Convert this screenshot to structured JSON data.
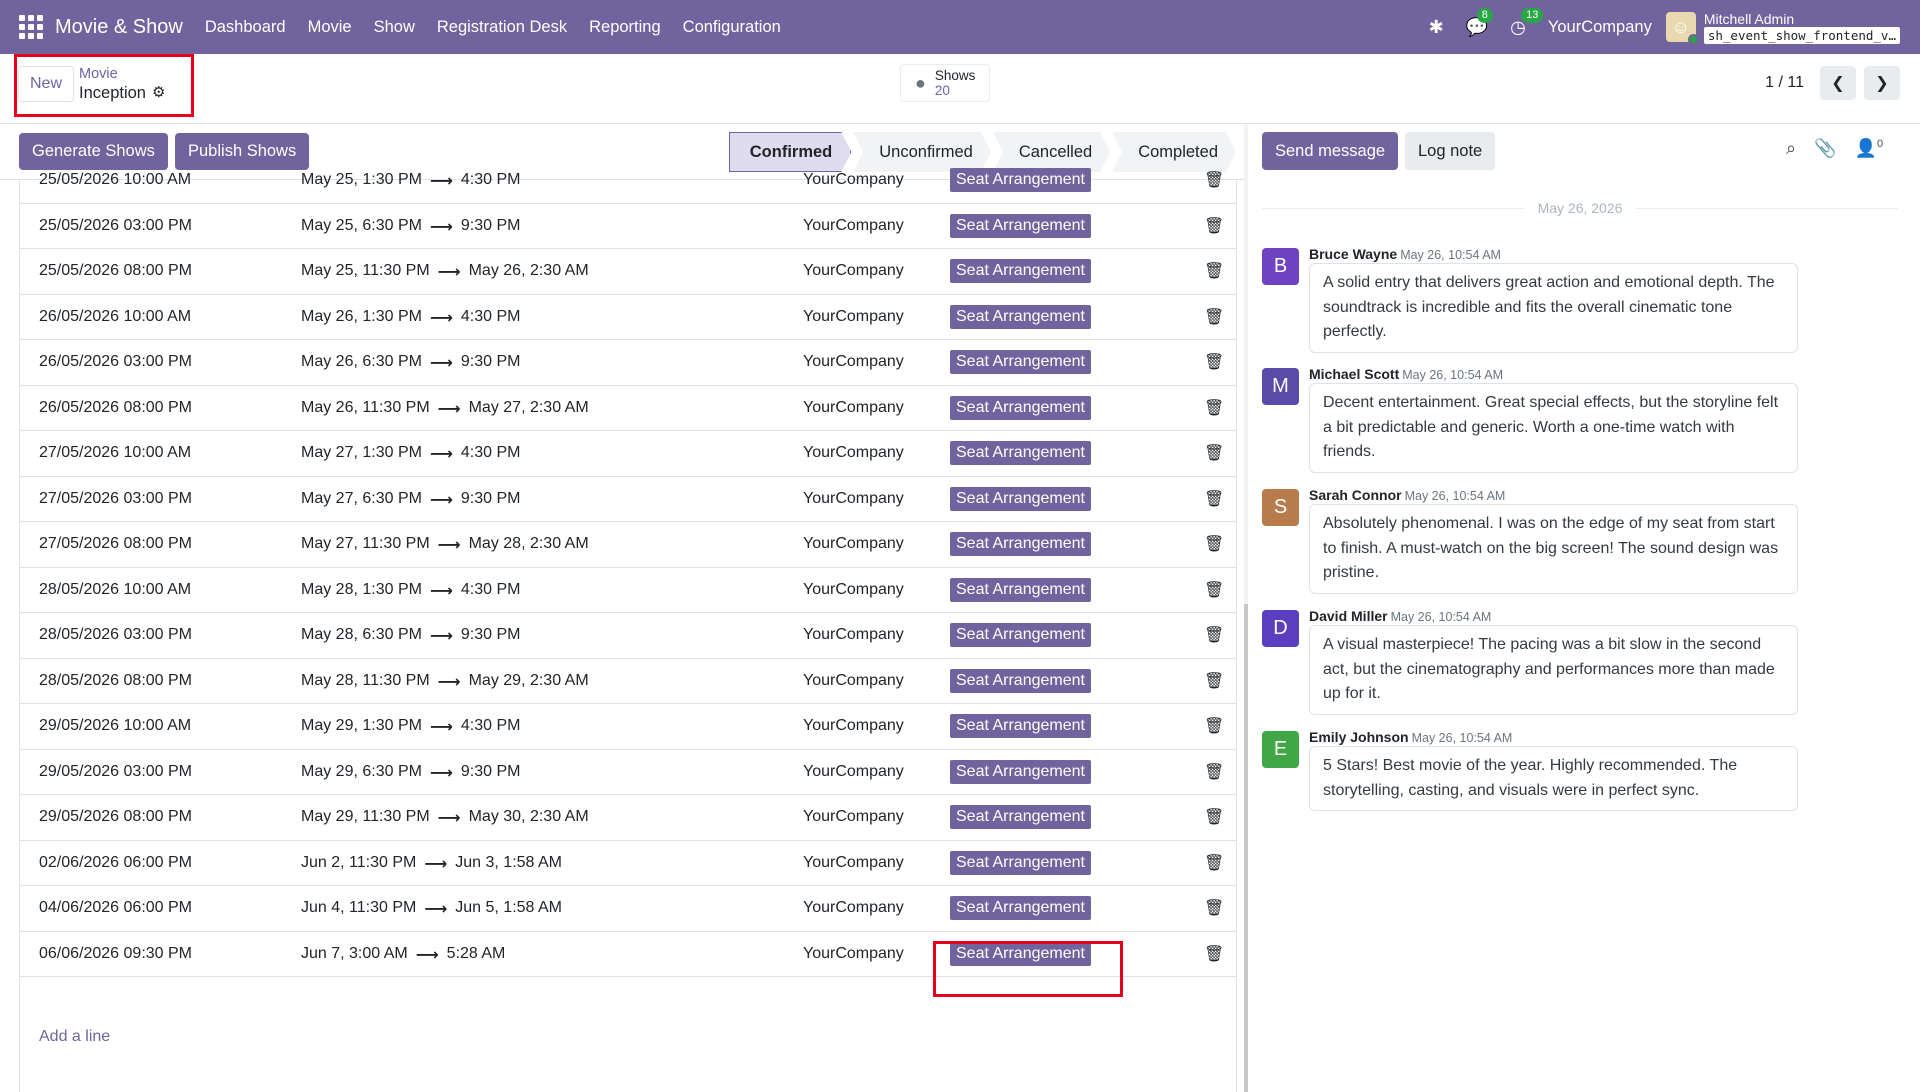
{
  "navbar": {
    "app_title": "Movie & Show",
    "menu": [
      "Dashboard",
      "Movie",
      "Show",
      "Registration Desk",
      "Reporting",
      "Configuration"
    ],
    "messages_count": "8",
    "activities_count": "13",
    "company": "YourCompany",
    "user_name": "Mitchell Admin",
    "database": "sh_event_show_frontend_v…"
  },
  "control_panel": {
    "new_label": "New",
    "breadcrumb_parent": "Movie",
    "breadcrumb_current": "Inception",
    "shows_label": "Shows",
    "shows_count": "20",
    "pager": "1 / 11"
  },
  "actions": {
    "generate": "Generate Shows",
    "publish": "Publish Shows"
  },
  "stages": [
    "Confirmed",
    "Unconfirmed",
    "Cancelled",
    "Completed"
  ],
  "active_stage": "Confirmed",
  "show_lines": [
    {
      "date": "25/05/2026 10:00 AM",
      "start": "May 25, 1:30 PM",
      "end": "4:30 PM",
      "company": "YourCompany",
      "action": "Seat Arrangement"
    },
    {
      "date": "25/05/2026 03:00 PM",
      "start": "May 25, 6:30 PM",
      "end": "9:30 PM",
      "company": "YourCompany",
      "action": "Seat Arrangement"
    },
    {
      "date": "25/05/2026 08:00 PM",
      "start": "May 25, 11:30 PM",
      "end": "May 26, 2:30 AM",
      "company": "YourCompany",
      "action": "Seat Arrangement"
    },
    {
      "date": "26/05/2026 10:00 AM",
      "start": "May 26, 1:30 PM",
      "end": "4:30 PM",
      "company": "YourCompany",
      "action": "Seat Arrangement"
    },
    {
      "date": "26/05/2026 03:00 PM",
      "start": "May 26, 6:30 PM",
      "end": "9:30 PM",
      "company": "YourCompany",
      "action": "Seat Arrangement"
    },
    {
      "date": "26/05/2026 08:00 PM",
      "start": "May 26, 11:30 PM",
      "end": "May 27, 2:30 AM",
      "company": "YourCompany",
      "action": "Seat Arrangement"
    },
    {
      "date": "27/05/2026 10:00 AM",
      "start": "May 27, 1:30 PM",
      "end": "4:30 PM",
      "company": "YourCompany",
      "action": "Seat Arrangement"
    },
    {
      "date": "27/05/2026 03:00 PM",
      "start": "May 27, 6:30 PM",
      "end": "9:30 PM",
      "company": "YourCompany",
      "action": "Seat Arrangement"
    },
    {
      "date": "27/05/2026 08:00 PM",
      "start": "May 27, 11:30 PM",
      "end": "May 28, 2:30 AM",
      "company": "YourCompany",
      "action": "Seat Arrangement"
    },
    {
      "date": "28/05/2026 10:00 AM",
      "start": "May 28, 1:30 PM",
      "end": "4:30 PM",
      "company": "YourCompany",
      "action": "Seat Arrangement"
    },
    {
      "date": "28/05/2026 03:00 PM",
      "start": "May 28, 6:30 PM",
      "end": "9:30 PM",
      "company": "YourCompany",
      "action": "Seat Arrangement"
    },
    {
      "date": "28/05/2026 08:00 PM",
      "start": "May 28, 11:30 PM",
      "end": "May 29, 2:30 AM",
      "company": "YourCompany",
      "action": "Seat Arrangement"
    },
    {
      "date": "29/05/2026 10:00 AM",
      "start": "May 29, 1:30 PM",
      "end": "4:30 PM",
      "company": "YourCompany",
      "action": "Seat Arrangement"
    },
    {
      "date": "29/05/2026 03:00 PM",
      "start": "May 29, 6:30 PM",
      "end": "9:30 PM",
      "company": "YourCompany",
      "action": "Seat Arrangement"
    },
    {
      "date": "29/05/2026 08:00 PM",
      "start": "May 29, 11:30 PM",
      "end": "May 30, 2:30 AM",
      "company": "YourCompany",
      "action": "Seat Arrangement"
    },
    {
      "date": "02/06/2026 06:00 PM",
      "start": "Jun 2, 11:30 PM",
      "end": "Jun 3, 1:58 AM",
      "company": "YourCompany",
      "action": "Seat Arrangement"
    },
    {
      "date": "04/06/2026 06:00 PM",
      "start": "Jun 4, 11:30 PM",
      "end": "Jun 5, 1:58 AM",
      "company": "YourCompany",
      "action": "Seat Arrangement"
    },
    {
      "date": "06/06/2026 09:30 PM",
      "start": "Jun 7, 3:00 AM",
      "end": "5:28 AM",
      "company": "YourCompany",
      "action": "Seat Arrangement"
    }
  ],
  "add_line": "Add a line",
  "chatter": {
    "send_message": "Send message",
    "log_note": "Log note",
    "followers_count": "0",
    "date_separator": "May 26, 2026",
    "messages": [
      {
        "initial": "B",
        "color": "#6f42c1",
        "author": "Bruce Wayne",
        "time": "May 26, 10:54 AM",
        "body": "A solid entry that delivers great action and emotional depth. The soundtrack is incredible and fits the overall cinematic tone perfectly."
      },
      {
        "initial": "M",
        "color": "#5b4ba8",
        "author": "Michael Scott",
        "time": "May 26, 10:54 AM",
        "body": "Decent entertainment. Great special effects, but the storyline felt a bit predictable and generic. Worth a one-time watch with friends."
      },
      {
        "initial": "S",
        "color": "#b87c4c",
        "author": "Sarah Connor",
        "time": "May 26, 10:54 AM",
        "body": "Absolutely phenomenal. I was on the edge of my seat from start to finish. A must-watch on the big screen! The sound design was pristine."
      },
      {
        "initial": "D",
        "color": "#5a3fc0",
        "author": "David Miller",
        "time": "May 26, 10:54 AM",
        "body": "A visual masterpiece! The pacing was a bit slow in the second act, but the cinematography and performances more than made up for it."
      },
      {
        "initial": "E",
        "color": "#3fa845",
        "author": "Emily Johnson",
        "time": "May 26, 10:54 AM",
        "body": "5 Stars! Best movie of the year. Highly recommended. The storytelling, casting, and visuals were in perfect sync."
      }
    ]
  }
}
